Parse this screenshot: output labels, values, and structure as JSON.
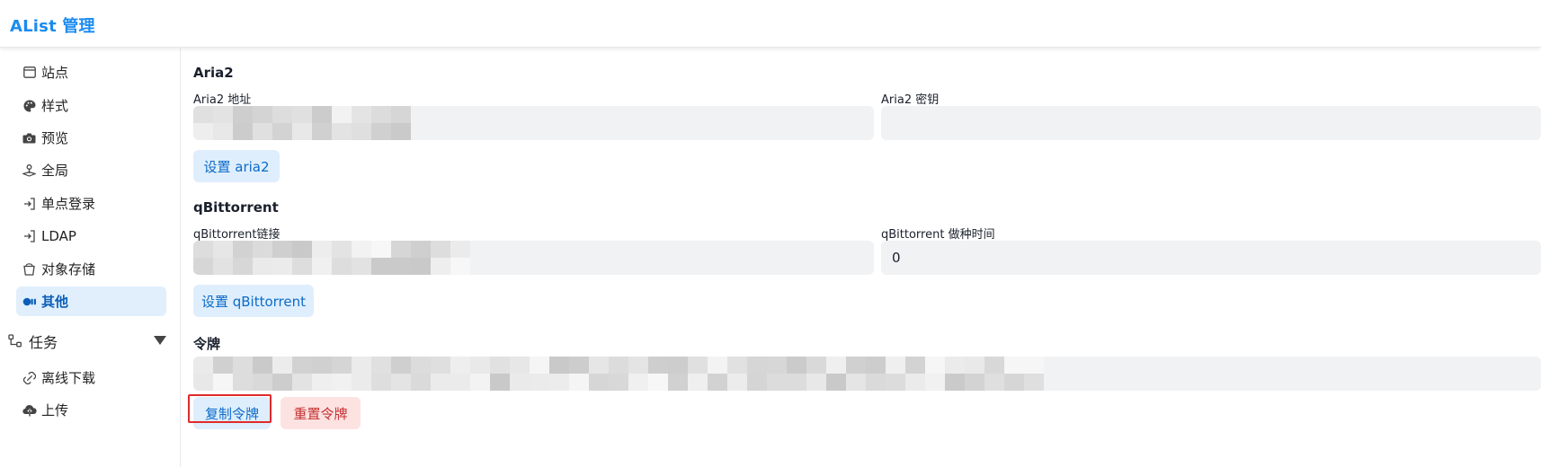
{
  "header": {
    "title": "AList 管理"
  },
  "sidebar": {
    "items": [
      {
        "label": "站点",
        "icon": "browser-window-icon",
        "active": false
      },
      {
        "label": "样式",
        "icon": "palette-icon",
        "active": false
      },
      {
        "label": "预览",
        "icon": "camera-icon",
        "active": false
      },
      {
        "label": "全局",
        "icon": "joystick-icon",
        "active": false
      },
      {
        "label": "单点登录",
        "icon": "sign-in-icon",
        "active": false
      },
      {
        "label": "LDAP",
        "icon": "sign-in-icon",
        "active": false
      },
      {
        "label": "对象存储",
        "icon": "bucket-icon",
        "active": false
      },
      {
        "label": "其他",
        "icon": "toggle-icon",
        "active": true
      }
    ],
    "group": {
      "label": "任务",
      "icon": "workflow-icon",
      "expanded": true
    },
    "sub_items": [
      {
        "label": "离线下载",
        "icon": "magnet-link-icon"
      },
      {
        "label": "上传",
        "icon": "cloud-upload-icon"
      }
    ]
  },
  "main": {
    "aria2": {
      "title": "Aria2",
      "address_label": "Aria2 地址",
      "address_value": "",
      "secret_label": "Aria2 密钥",
      "secret_value": "",
      "button": "设置 aria2"
    },
    "qbittorrent": {
      "title": "qBittorrent",
      "url_label": "qBittorrent链接",
      "url_value": "",
      "seedtime_label": "qBittorrent 做种时间",
      "seedtime_value": "0",
      "button": "设置 qBittorrent"
    },
    "token": {
      "title": "令牌",
      "value": "",
      "copy_button": "复制令牌",
      "reset_button": "重置令牌"
    }
  },
  "colors": {
    "accent": "#1a8bf0",
    "active_bg": "#e1effd",
    "field_bg": "#f1f2f4",
    "danger_bg": "#fde2e2",
    "danger_text": "#c53030",
    "focus_outline": "#e02b2b"
  }
}
